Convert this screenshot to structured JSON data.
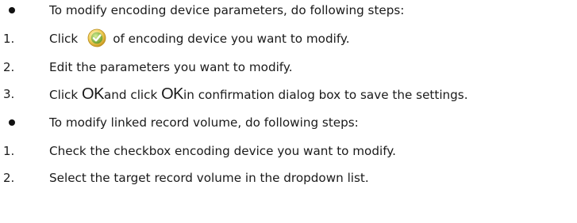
{
  "colors": {
    "text": "#1a1a1a",
    "bullet": "#111111",
    "icon_outer": "#e8c24a",
    "icon_inner": "#8dbb3c",
    "icon_check": "#ffffff"
  },
  "icons": {
    "modify": "check-circle-icon",
    "bullet": "bullet-dot-icon"
  },
  "lines": [
    {
      "marker": "",
      "text": "To modify encoding device parameters, do following steps:"
    },
    {
      "marker": "1.",
      "before": "Click",
      "after": "of encoding device you want to modify."
    },
    {
      "marker": "2.",
      "text": "Edit the parameters you want to modify."
    },
    {
      "marker": "3.",
      "parts": [
        "Click ",
        "OK",
        "and click ",
        "OK",
        "in confirmation dialog box to save the settings."
      ]
    },
    {
      "marker": "",
      "text": "To modify linked record volume, do following steps:"
    },
    {
      "marker": "1.",
      "text": "Check the checkbox encoding device you want to modify."
    },
    {
      "marker": "2.",
      "text": "Select the target record volume in the dropdown list."
    }
  ]
}
